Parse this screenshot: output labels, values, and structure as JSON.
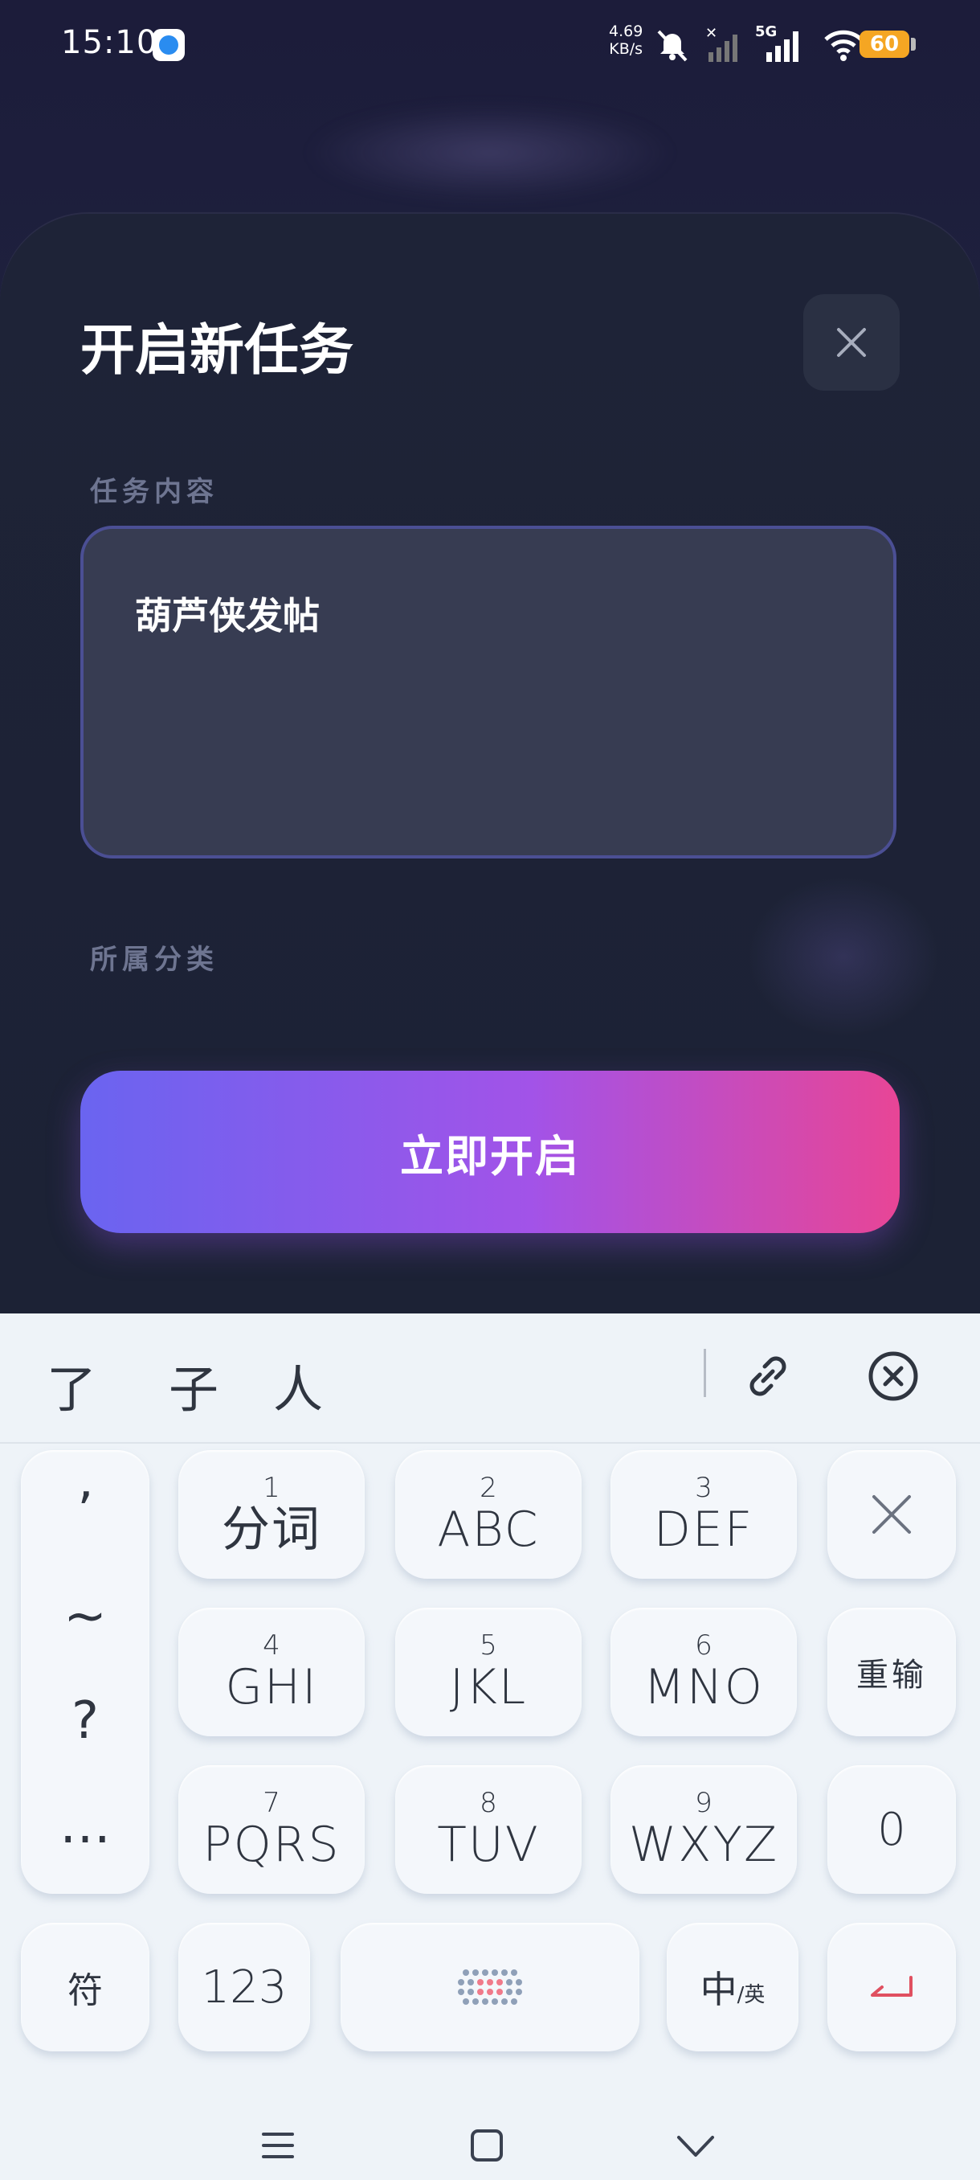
{
  "status_bar": {
    "time": "15:10",
    "speed_value": "4.69",
    "speed_unit": "KB/s",
    "network": "5G",
    "battery": "60"
  },
  "sheet": {
    "title": "开启新任务",
    "content_label": "任务内容",
    "content_value": "葫芦侠发帖",
    "category_label": "所属分类",
    "start_button": "立即开启"
  },
  "keyboard": {
    "candidates": [
      "了",
      "子",
      "人"
    ],
    "keys": [
      {
        "num": "1",
        "letters": "分词"
      },
      {
        "num": "2",
        "letters": "ABC"
      },
      {
        "num": "3",
        "letters": "DEF"
      },
      {
        "num": "4",
        "letters": "GHI"
      },
      {
        "num": "5",
        "letters": "JKL"
      },
      {
        "num": "6",
        "letters": "MNO"
      },
      {
        "num": "7",
        "letters": "PQRS"
      },
      {
        "num": "8",
        "letters": "TUV"
      },
      {
        "num": "9",
        "letters": "WXYZ"
      }
    ],
    "punctuation": [
      "’",
      "~",
      "?",
      "…"
    ],
    "reinput": "重输",
    "zero": "0",
    "symbol": "符",
    "num_mode": "123",
    "lang_main": "中",
    "lang_sub": "/英"
  },
  "colors": {
    "accent_start": "#6a64f0",
    "accent_end": "#e84596",
    "textarea_border": "#4b4f94",
    "enter_icon": "#e05060"
  }
}
